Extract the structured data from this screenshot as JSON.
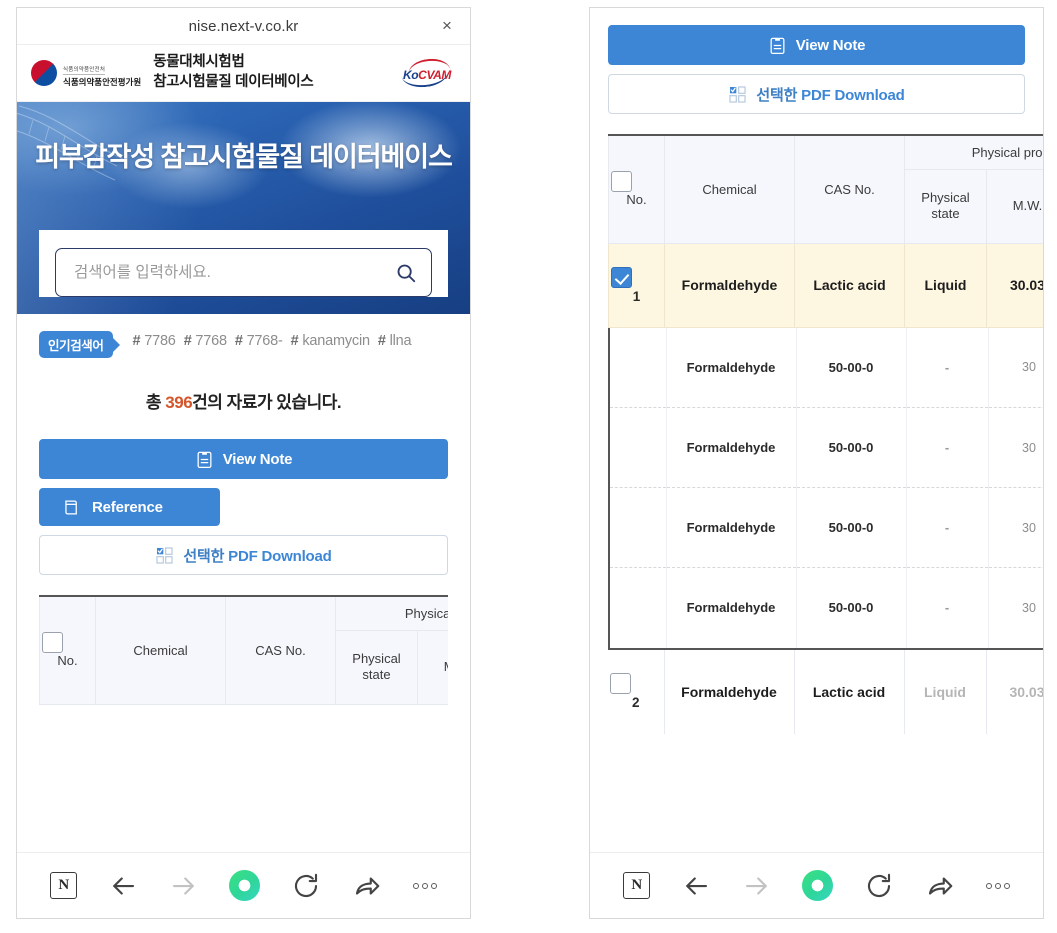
{
  "browser": {
    "url": "nise.next-v.co.kr",
    "close_label": "×",
    "nav": {
      "naver_label": "N",
      "back_icon": "arrow-left-icon",
      "forward_icon": "arrow-right-icon",
      "home_icon": "naver-home-icon",
      "refresh_icon": "refresh-icon",
      "share_icon": "share-icon",
      "menu_icon": "more-options-icon"
    }
  },
  "site_header": {
    "agency_small": "식품의약품안전처",
    "agency_large": "식품의약품안전평가원",
    "title_line1": "동물대체시험법",
    "title_line2": "참고시험물질 데이터베이스",
    "brand_ko": "Ko",
    "brand_cvam": "CVAM"
  },
  "hero": {
    "title": "피부감작성 참고시험물질 데이터베이스"
  },
  "search": {
    "placeholder": "검색어를 입력하세요.",
    "value": "",
    "icon": "search-icon"
  },
  "popular": {
    "label": "인기검색어",
    "tags": [
      "# 7786",
      "# 7768",
      "# 7768-",
      "# kanamycin",
      "# llna"
    ]
  },
  "result_count": {
    "prefix": "총 ",
    "number": "396",
    "suffix": "건의 자료가 있습니다."
  },
  "actions": {
    "view_note": "View Note",
    "reference": "Reference",
    "pdf_download_ko": "선택한 ",
    "pdf_download_en": "PDF Download"
  },
  "table": {
    "group_header_left": "Physical prope",
    "group_header_right": "Physical proper",
    "columns": {
      "no": "No.",
      "chemical": "Chemical",
      "cas": "CAS No.",
      "physical_state": "Physical state",
      "mw": "M.W.",
      "partial": "("
    },
    "rows": [
      {
        "no": "1",
        "checked": true,
        "chemical": "Formaldehyde",
        "cas": "Lactic acid",
        "physical_state": "Liquid",
        "mw": "30.03",
        "subrows": [
          {
            "chemical": "Formaldehyde",
            "cas": "50-00-0",
            "physical_state": "-",
            "mw": "30"
          },
          {
            "chemical": "Formaldehyde",
            "cas": "50-00-0",
            "physical_state": "-",
            "mw": "30"
          },
          {
            "chemical": "Formaldehyde",
            "cas": "50-00-0",
            "physical_state": "-",
            "mw": "30"
          },
          {
            "chemical": "Formaldehyde",
            "cas": "50-00-0",
            "physical_state": "-",
            "mw": "30"
          }
        ]
      },
      {
        "no": "2",
        "checked": false,
        "chemical": "Formaldehyde",
        "cas": "Lactic acid",
        "physical_state": "Liquid",
        "mw": "30.03",
        "subrows": []
      }
    ]
  },
  "colors": {
    "accent_blue": "#3d86d6",
    "hero_blue": "#1f4f9c",
    "selected_row": "#fdf6e1",
    "count_number": "#d4562a",
    "home_green": "#2fd69a"
  }
}
